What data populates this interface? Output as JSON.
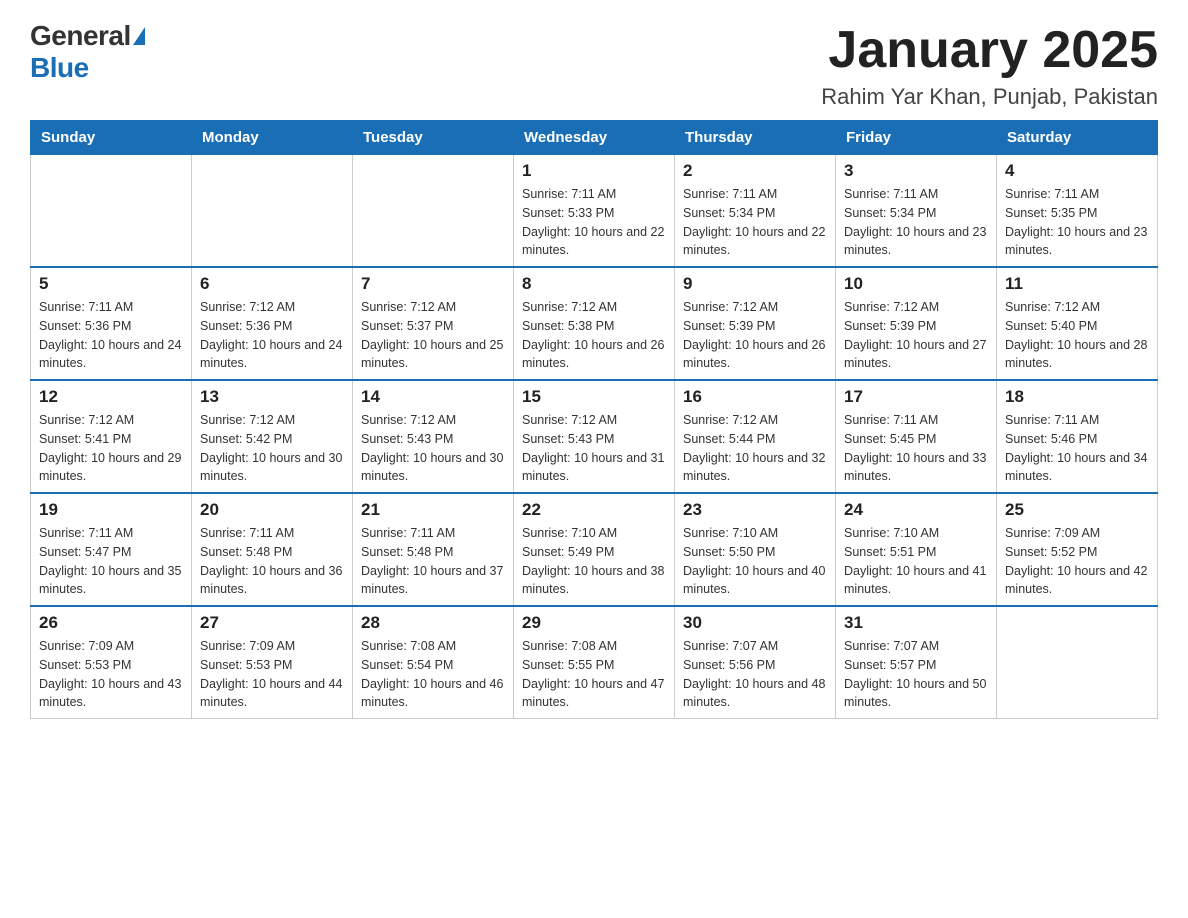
{
  "header": {
    "logo_general": "General",
    "logo_blue": "Blue",
    "title": "January 2025",
    "subtitle": "Rahim Yar Khan, Punjab, Pakistan"
  },
  "days_of_week": [
    "Sunday",
    "Monday",
    "Tuesday",
    "Wednesday",
    "Thursday",
    "Friday",
    "Saturday"
  ],
  "weeks": [
    [
      {
        "day": "",
        "info": ""
      },
      {
        "day": "",
        "info": ""
      },
      {
        "day": "",
        "info": ""
      },
      {
        "day": "1",
        "info": "Sunrise: 7:11 AM\nSunset: 5:33 PM\nDaylight: 10 hours and 22 minutes."
      },
      {
        "day": "2",
        "info": "Sunrise: 7:11 AM\nSunset: 5:34 PM\nDaylight: 10 hours and 22 minutes."
      },
      {
        "day": "3",
        "info": "Sunrise: 7:11 AM\nSunset: 5:34 PM\nDaylight: 10 hours and 23 minutes."
      },
      {
        "day": "4",
        "info": "Sunrise: 7:11 AM\nSunset: 5:35 PM\nDaylight: 10 hours and 23 minutes."
      }
    ],
    [
      {
        "day": "5",
        "info": "Sunrise: 7:11 AM\nSunset: 5:36 PM\nDaylight: 10 hours and 24 minutes."
      },
      {
        "day": "6",
        "info": "Sunrise: 7:12 AM\nSunset: 5:36 PM\nDaylight: 10 hours and 24 minutes."
      },
      {
        "day": "7",
        "info": "Sunrise: 7:12 AM\nSunset: 5:37 PM\nDaylight: 10 hours and 25 minutes."
      },
      {
        "day": "8",
        "info": "Sunrise: 7:12 AM\nSunset: 5:38 PM\nDaylight: 10 hours and 26 minutes."
      },
      {
        "day": "9",
        "info": "Sunrise: 7:12 AM\nSunset: 5:39 PM\nDaylight: 10 hours and 26 minutes."
      },
      {
        "day": "10",
        "info": "Sunrise: 7:12 AM\nSunset: 5:39 PM\nDaylight: 10 hours and 27 minutes."
      },
      {
        "day": "11",
        "info": "Sunrise: 7:12 AM\nSunset: 5:40 PM\nDaylight: 10 hours and 28 minutes."
      }
    ],
    [
      {
        "day": "12",
        "info": "Sunrise: 7:12 AM\nSunset: 5:41 PM\nDaylight: 10 hours and 29 minutes."
      },
      {
        "day": "13",
        "info": "Sunrise: 7:12 AM\nSunset: 5:42 PM\nDaylight: 10 hours and 30 minutes."
      },
      {
        "day": "14",
        "info": "Sunrise: 7:12 AM\nSunset: 5:43 PM\nDaylight: 10 hours and 30 minutes."
      },
      {
        "day": "15",
        "info": "Sunrise: 7:12 AM\nSunset: 5:43 PM\nDaylight: 10 hours and 31 minutes."
      },
      {
        "day": "16",
        "info": "Sunrise: 7:12 AM\nSunset: 5:44 PM\nDaylight: 10 hours and 32 minutes."
      },
      {
        "day": "17",
        "info": "Sunrise: 7:11 AM\nSunset: 5:45 PM\nDaylight: 10 hours and 33 minutes."
      },
      {
        "day": "18",
        "info": "Sunrise: 7:11 AM\nSunset: 5:46 PM\nDaylight: 10 hours and 34 minutes."
      }
    ],
    [
      {
        "day": "19",
        "info": "Sunrise: 7:11 AM\nSunset: 5:47 PM\nDaylight: 10 hours and 35 minutes."
      },
      {
        "day": "20",
        "info": "Sunrise: 7:11 AM\nSunset: 5:48 PM\nDaylight: 10 hours and 36 minutes."
      },
      {
        "day": "21",
        "info": "Sunrise: 7:11 AM\nSunset: 5:48 PM\nDaylight: 10 hours and 37 minutes."
      },
      {
        "day": "22",
        "info": "Sunrise: 7:10 AM\nSunset: 5:49 PM\nDaylight: 10 hours and 38 minutes."
      },
      {
        "day": "23",
        "info": "Sunrise: 7:10 AM\nSunset: 5:50 PM\nDaylight: 10 hours and 40 minutes."
      },
      {
        "day": "24",
        "info": "Sunrise: 7:10 AM\nSunset: 5:51 PM\nDaylight: 10 hours and 41 minutes."
      },
      {
        "day": "25",
        "info": "Sunrise: 7:09 AM\nSunset: 5:52 PM\nDaylight: 10 hours and 42 minutes."
      }
    ],
    [
      {
        "day": "26",
        "info": "Sunrise: 7:09 AM\nSunset: 5:53 PM\nDaylight: 10 hours and 43 minutes."
      },
      {
        "day": "27",
        "info": "Sunrise: 7:09 AM\nSunset: 5:53 PM\nDaylight: 10 hours and 44 minutes."
      },
      {
        "day": "28",
        "info": "Sunrise: 7:08 AM\nSunset: 5:54 PM\nDaylight: 10 hours and 46 minutes."
      },
      {
        "day": "29",
        "info": "Sunrise: 7:08 AM\nSunset: 5:55 PM\nDaylight: 10 hours and 47 minutes."
      },
      {
        "day": "30",
        "info": "Sunrise: 7:07 AM\nSunset: 5:56 PM\nDaylight: 10 hours and 48 minutes."
      },
      {
        "day": "31",
        "info": "Sunrise: 7:07 AM\nSunset: 5:57 PM\nDaylight: 10 hours and 50 minutes."
      },
      {
        "day": "",
        "info": ""
      }
    ]
  ]
}
